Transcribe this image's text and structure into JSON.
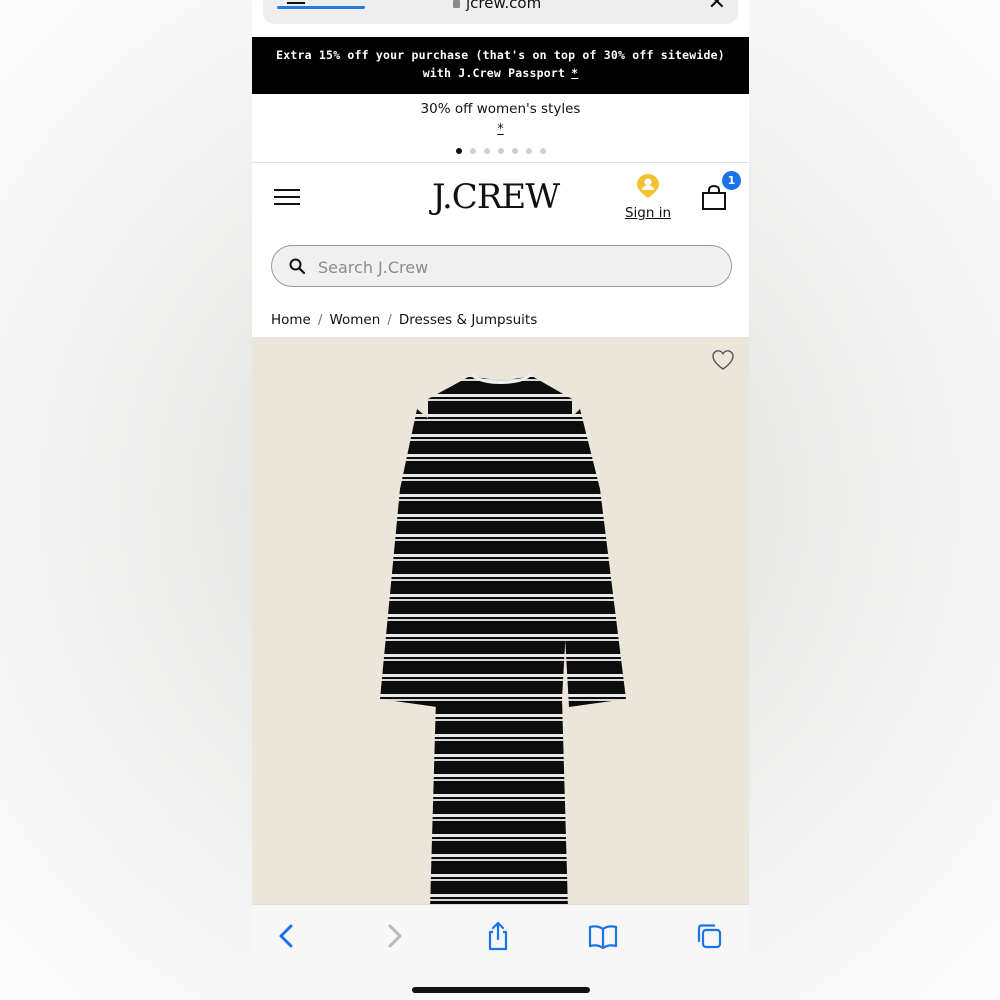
{
  "browser": {
    "url": "jcrew.com",
    "close_label": "✕"
  },
  "promo": {
    "line1": "Extra 15% off your purchase (that's on top of 30% off sitewide)",
    "line2": "with J.Crew Passport",
    "line2_asterisk": "*",
    "secondary": "30% off women's styles",
    "secondary_asterisk": "*",
    "carousel_count": 7,
    "carousel_active": 1
  },
  "header": {
    "logo": "J.CREW",
    "signin_label": "Sign in",
    "bag_count": "1"
  },
  "search": {
    "placeholder": "Search J.Crew",
    "value": ""
  },
  "breadcrumb": [
    "Home",
    "Women",
    "Dresses & Jumpsuits"
  ],
  "colors": {
    "accent_blue": "#1a73e8",
    "signin_yellow": "#f2c230",
    "product_bg": "#ebe5da",
    "promo_bg": "#000000"
  },
  "icons": {
    "menu": "hamburger-menu-icon",
    "account": "user-location-icon",
    "bag": "shopping-bag-icon",
    "search": "search-icon",
    "wishlist": "heart-icon",
    "back": "chevron-left-icon",
    "forward": "chevron-right-icon",
    "share": "share-icon",
    "bookmarks": "book-icon",
    "tabs": "tabs-icon"
  }
}
